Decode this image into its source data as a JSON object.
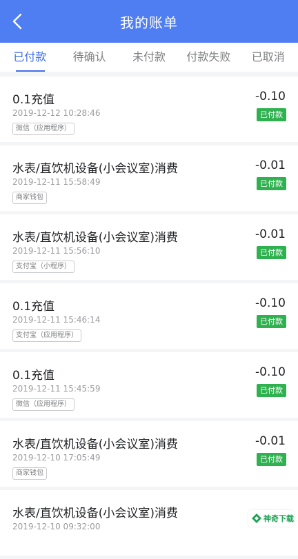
{
  "header": {
    "title": "我的账单"
  },
  "tabs": [
    {
      "label": "已付款"
    },
    {
      "label": "待确认"
    },
    {
      "label": "未付款"
    },
    {
      "label": "付款失败"
    },
    {
      "label": "已取消"
    }
  ],
  "active_tab": "已付款",
  "bills": [
    {
      "title": "0.1充值",
      "datetime": "2019-12-12 10:28:46",
      "source": "微信（应用程序）",
      "amount": "-0.10",
      "status": "已付款"
    },
    {
      "title": "水表/直饮机设备(小会议室)消费",
      "datetime": "2019-12-11 15:58:49",
      "source": "商家钱包",
      "amount": "-0.01",
      "status": "已付款"
    },
    {
      "title": "水表/直饮机设备(小会议室)消费",
      "datetime": "2019-12-11 15:56:10",
      "source": "支付宝（小程序）",
      "amount": "-0.01",
      "status": "已付款"
    },
    {
      "title": "0.1充值",
      "datetime": "2019-12-11 15:46:14",
      "source": "支付宝（应用程序）",
      "amount": "-0.10",
      "status": "已付款"
    },
    {
      "title": "0.1充值",
      "datetime": "2019-12-11 15:45:59",
      "source": "微信（应用程序）",
      "amount": "-0.10",
      "status": "已付款"
    },
    {
      "title": "水表/直饮机设备(小会议室)消费",
      "datetime": "2019-12-10 17:05:49",
      "source": "商家钱包",
      "amount": "-0.01",
      "status": "已付款"
    },
    {
      "title": "水表/直饮机设备(小会议室)消费",
      "datetime": "2019-12-10 09:32:00",
      "source": "",
      "amount": "",
      "status": ""
    }
  ],
  "watermark": {
    "label": "神奇下载"
  },
  "colors": {
    "header_bg": "#4f7df2",
    "accent": "#3f6fe9",
    "status_paid": "#2fb14f"
  }
}
